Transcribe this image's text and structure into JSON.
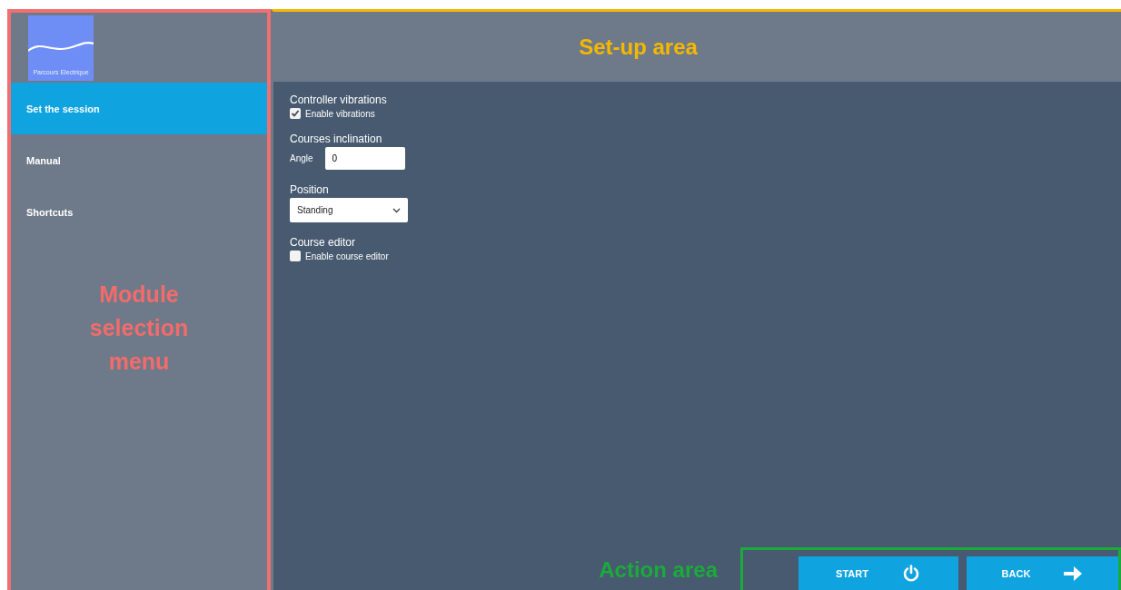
{
  "logo": {
    "caption": "Parcours Electrique"
  },
  "sidebar": {
    "items": [
      {
        "label": "Set the session",
        "selected": true
      },
      {
        "label": "Manual",
        "selected": false
      },
      {
        "label": "Shortcuts",
        "selected": false
      }
    ]
  },
  "settings": [
    {
      "kind": "checkbox",
      "title": "Controller vibrations",
      "label": "Enable vibrations",
      "checked": true
    },
    {
      "kind": "number",
      "title": "Courses inclination",
      "label": "Angle",
      "value": "0"
    },
    {
      "kind": "dropdown",
      "title": "Position",
      "value": "Standing"
    },
    {
      "kind": "checkbox",
      "title": "Course editor",
      "label": "Enable course editor",
      "checked": false
    }
  ],
  "actions": [
    {
      "kind": "start",
      "label": "START"
    },
    {
      "kind": "back",
      "label": "BACK"
    }
  ],
  "annotations": {
    "setup_area": "Set-up area",
    "module_menu": "Module selection menu",
    "action_area": "Action area"
  }
}
